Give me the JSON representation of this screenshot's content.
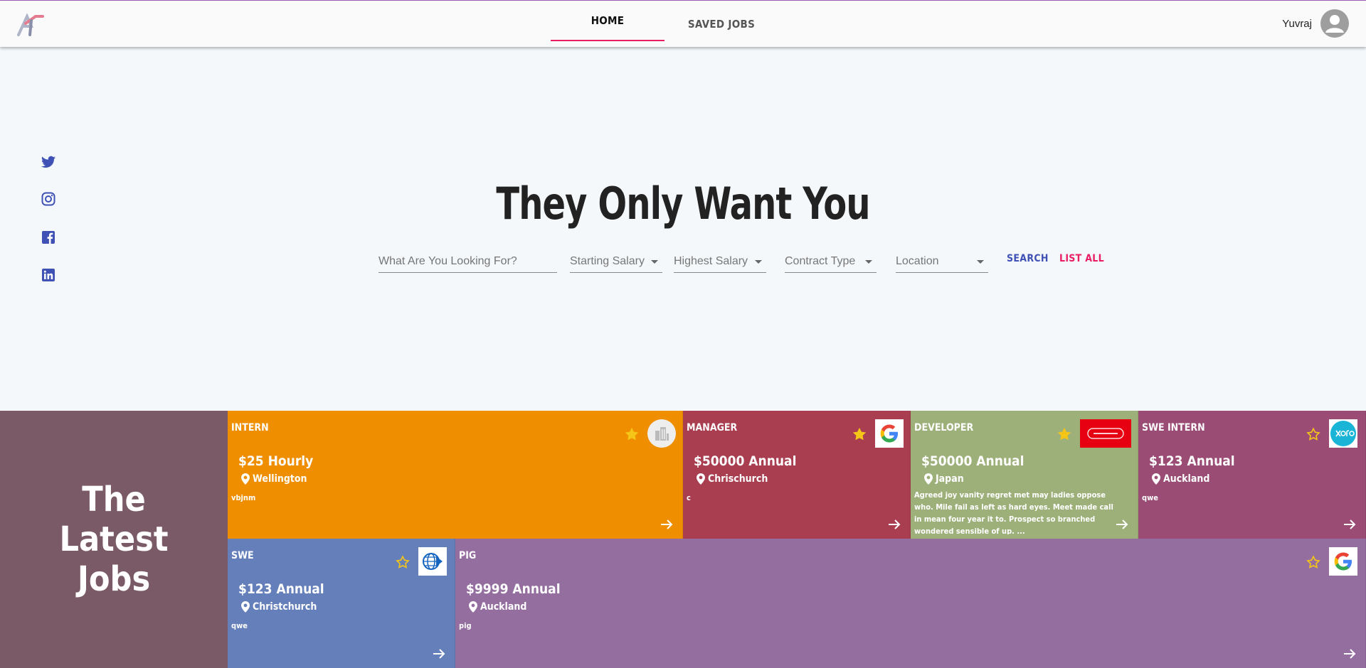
{
  "header": {
    "nav": [
      {
        "label": "HOME"
      },
      {
        "label": "SAVED JOBS"
      }
    ],
    "user": "Yuvraj"
  },
  "social": [
    "twitter-icon",
    "instagram-icon",
    "facebook-icon",
    "linkedin-icon"
  ],
  "hero": {
    "title": "They Only Want You",
    "search_placeholder": "What Are You Looking For?",
    "filters": {
      "starting_salary": "Starting Salary",
      "highest_salary": "Highest Salary",
      "contract_type": "Contract Type",
      "location": "Location"
    },
    "search_label": "SEARCH",
    "list_all_label": "LIST ALL"
  },
  "latest": {
    "line1": "The",
    "line2": "Latest",
    "line3": "Jobs"
  },
  "colors": {
    "accent_pink": "#e91e63",
    "accent_indigo": "#3f51b5",
    "star": "#f5c518"
  },
  "jobs": [
    {
      "title": "INTERN",
      "salary": "$25 Hourly",
      "location": "Wellington",
      "desc": "vbjnm",
      "starred": true,
      "company_logo": "building-icon",
      "color": "#ef8f00"
    },
    {
      "title": "MANAGER",
      "salary": "$50000 Annual",
      "location": "Chrischurch",
      "desc": "c",
      "starred": true,
      "company_logo": "google-logo",
      "color": "#a83e4f"
    },
    {
      "title": "DEVELOPER",
      "salary": "$50000 Annual",
      "location": "Japan",
      "desc": "Agreed joy vanity regret met may ladies oppose who. Mile fail as left as hard eyes. Meet made call in mean four year it to. Prospect so branched wondered sensible of up. ...",
      "starred": true,
      "company_logo": "nintendo-logo",
      "color": "#9db07a"
    },
    {
      "title": "SWE INTERN",
      "salary": "$123 Annual",
      "location": "Auckland",
      "desc": "qwe",
      "starred": false,
      "company_logo": "xero-logo",
      "color": "#9a4c74"
    },
    {
      "title": "SWE",
      "salary": "$123 Annual",
      "location": "Christchurch",
      "desc": "qwe",
      "starred": false,
      "company_logo": "globe-logo",
      "color": "#657fba"
    },
    {
      "title": "PIG",
      "salary": "$9999 Annual",
      "location": "Auckland",
      "desc": "pig",
      "starred": false,
      "company_logo": "google-logo",
      "color": "#946e9f"
    }
  ]
}
